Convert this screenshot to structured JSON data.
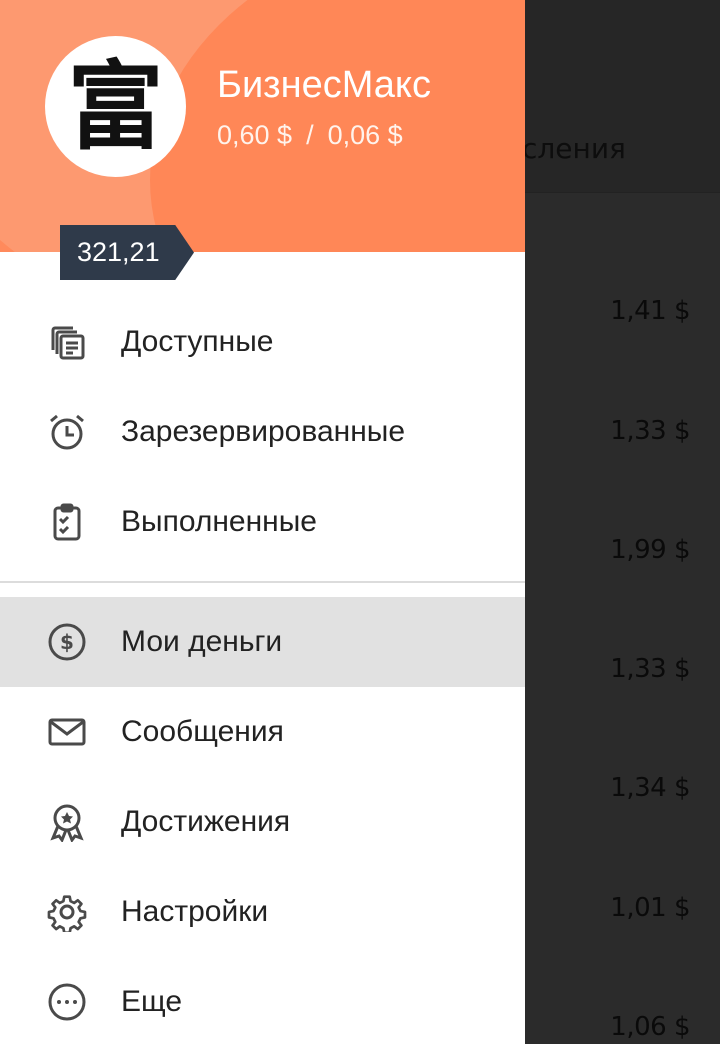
{
  "background": {
    "header_text": "сления",
    "prices": [
      "1,41 $",
      "1,33 $",
      "1,99 $",
      "1,33 $",
      "1,34 $",
      "1,01 $",
      "1,06 $"
    ]
  },
  "drawer": {
    "avatar_glyph": "富",
    "user_name": "БизнесМакс",
    "stat_left": "0,60 $",
    "stat_sep": "/",
    "stat_right": "0,06 $",
    "rating": "321,21",
    "menu_group1": [
      {
        "label": "Доступные",
        "icon": "list-icon"
      },
      {
        "label": "Зарезервированные",
        "icon": "alarm-clock-icon"
      },
      {
        "label": "Выполненные",
        "icon": "clipboard-check-icon"
      }
    ],
    "menu_group2": [
      {
        "label": "Мои деньги",
        "icon": "dollar-coin-icon",
        "active": true
      },
      {
        "label": "Сообщения",
        "icon": "mail-icon"
      },
      {
        "label": "Достижения",
        "icon": "award-icon"
      },
      {
        "label": "Настройки",
        "icon": "gear-icon"
      },
      {
        "label": "Еще",
        "icon": "more-icon"
      }
    ]
  },
  "colors": {
    "header_orange": "#ff8a5c",
    "badge_dark": "#2f3a4a",
    "active_bg": "#e1e1e1"
  }
}
